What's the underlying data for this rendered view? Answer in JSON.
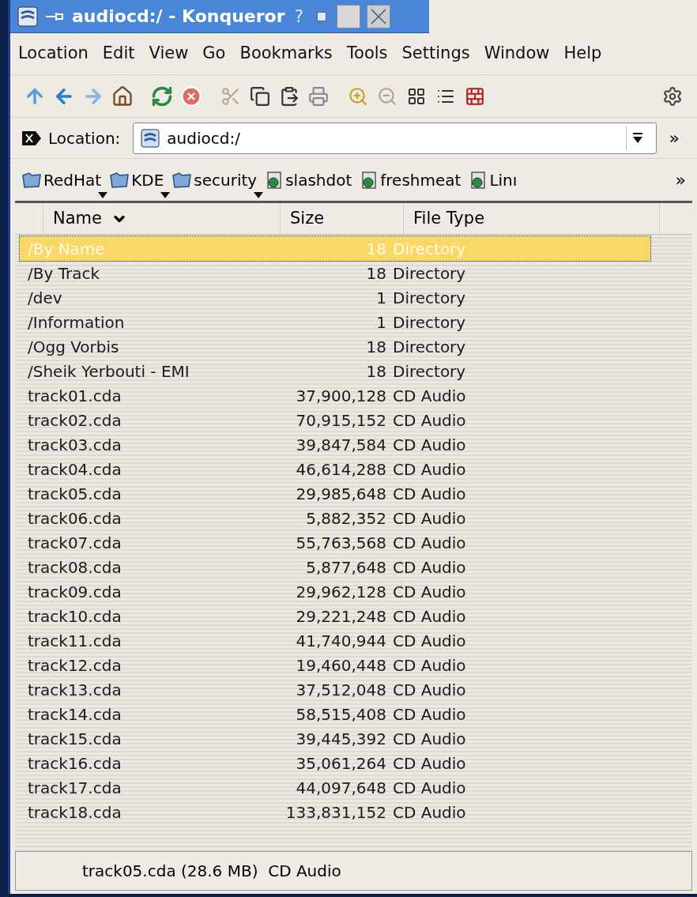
{
  "window": {
    "title": "audiocd:/ - Konqueror",
    "help_glyph": "?"
  },
  "menu": [
    "Location",
    "Edit",
    "View",
    "Go",
    "Bookmarks",
    "Tools",
    "Settings",
    "Window",
    "Help"
  ],
  "location": {
    "label": "Location:",
    "value": "audiocd:/",
    "more": "»"
  },
  "bookmarks": {
    "items": [
      {
        "label": "RedHat",
        "kind": "folder"
      },
      {
        "label": "KDE",
        "kind": "folder"
      },
      {
        "label": "security",
        "kind": "folder"
      },
      {
        "label": "slashdot",
        "kind": "page"
      },
      {
        "label": "freshmeat",
        "kind": "page"
      },
      {
        "label": "Linı",
        "kind": "page"
      }
    ],
    "more": "»"
  },
  "table": {
    "columns": [
      {
        "label": "Name",
        "sorted": true
      },
      {
        "label": "Size",
        "sorted": false
      },
      {
        "label": "File Type",
        "sorted": false
      }
    ],
    "rows": [
      {
        "name": "/By Name",
        "size": "18",
        "type": "Directory",
        "selected": true
      },
      {
        "name": "/By Track",
        "size": "18",
        "type": "Directory",
        "selected": false
      },
      {
        "name": "/dev",
        "size": "1",
        "type": "Directory",
        "selected": false
      },
      {
        "name": "/Information",
        "size": "1",
        "type": "Directory",
        "selected": false
      },
      {
        "name": "/Ogg Vorbis",
        "size": "18",
        "type": "Directory",
        "selected": false
      },
      {
        "name": "/Sheik Yerbouti - EMI",
        "size": "18",
        "type": "Directory",
        "selected": false
      },
      {
        "name": "track01.cda",
        "size": "37,900,128",
        "type": "CD Audio",
        "selected": false
      },
      {
        "name": "track02.cda",
        "size": "70,915,152",
        "type": "CD Audio",
        "selected": false
      },
      {
        "name": "track03.cda",
        "size": "39,847,584",
        "type": "CD Audio",
        "selected": false
      },
      {
        "name": "track04.cda",
        "size": "46,614,288",
        "type": "CD Audio",
        "selected": false
      },
      {
        "name": "track05.cda",
        "size": "29,985,648",
        "type": "CD Audio",
        "selected": false
      },
      {
        "name": "track06.cda",
        "size": "5,882,352",
        "type": "CD Audio",
        "selected": false
      },
      {
        "name": "track07.cda",
        "size": "55,763,568",
        "type": "CD Audio",
        "selected": false
      },
      {
        "name": "track08.cda",
        "size": "5,877,648",
        "type": "CD Audio",
        "selected": false
      },
      {
        "name": "track09.cda",
        "size": "29,962,128",
        "type": "CD Audio",
        "selected": false
      },
      {
        "name": "track10.cda",
        "size": "29,221,248",
        "type": "CD Audio",
        "selected": false
      },
      {
        "name": "track11.cda",
        "size": "41,740,944",
        "type": "CD Audio",
        "selected": false
      },
      {
        "name": "track12.cda",
        "size": "19,460,448",
        "type": "CD Audio",
        "selected": false
      },
      {
        "name": "track13.cda",
        "size": "37,512,048",
        "type": "CD Audio",
        "selected": false
      },
      {
        "name": "track14.cda",
        "size": "58,515,408",
        "type": "CD Audio",
        "selected": false
      },
      {
        "name": "track15.cda",
        "size": "39,445,392",
        "type": "CD Audio",
        "selected": false
      },
      {
        "name": "track16.cda",
        "size": "35,061,264",
        "type": "CD Audio",
        "selected": false
      },
      {
        "name": "track17.cda",
        "size": "44,097,648",
        "type": "CD Audio",
        "selected": false
      },
      {
        "name": "track18.cda",
        "size": "133,831,152",
        "type": "CD Audio",
        "selected": false
      }
    ]
  },
  "status_bar": "track05.cda (28.6 MB)  CD Audio"
}
